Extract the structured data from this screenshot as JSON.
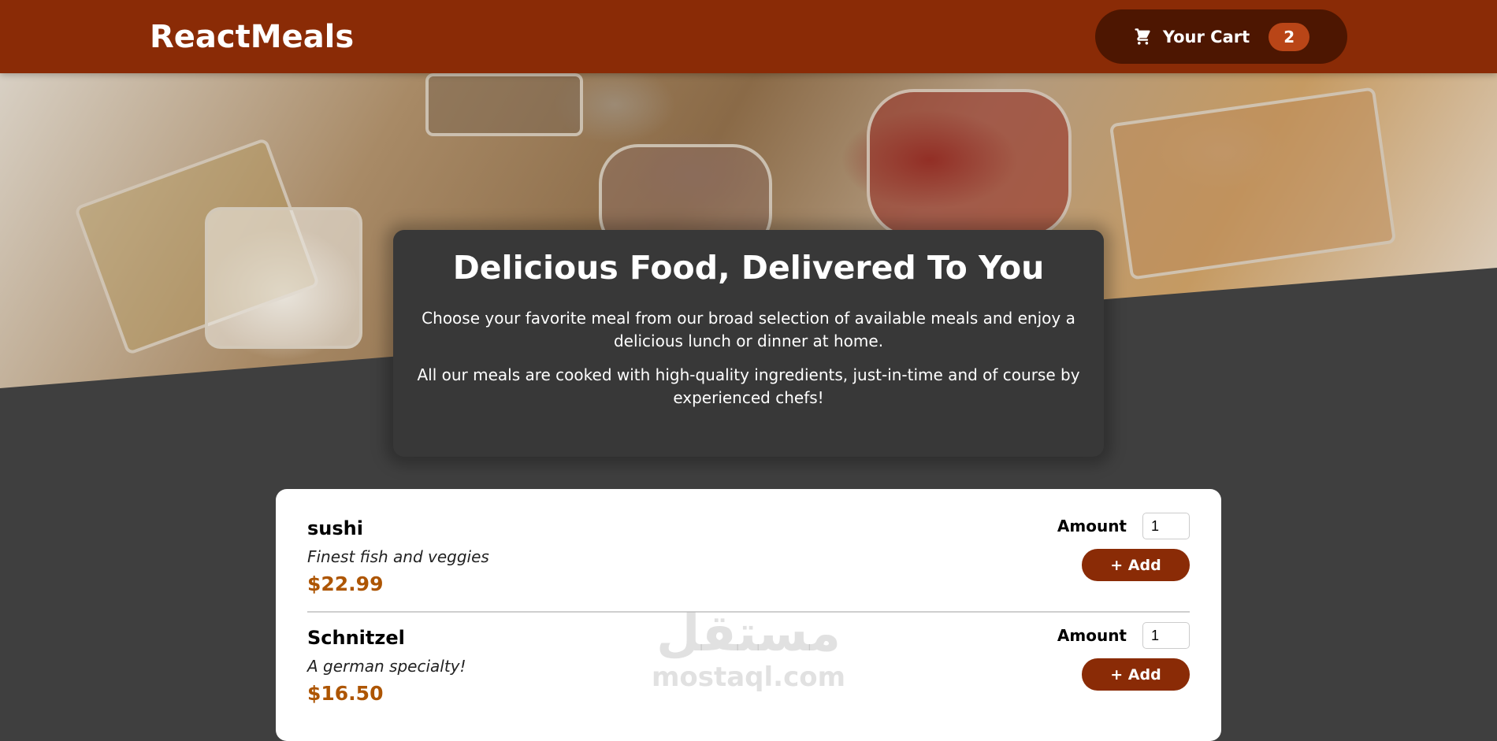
{
  "header": {
    "brand": "ReactMeals",
    "cart": {
      "icon": "cart-icon",
      "label": "Your Cart",
      "count": "2"
    }
  },
  "hero": {
    "image": "buffet-table-image"
  },
  "summary": {
    "title": "Delicious Food, Delivered To You",
    "paragraph1": "Choose your favorite meal from our broad selection of available meals and enjoy a delicious lunch or dinner at home.",
    "paragraph2": "All our meals are cooked with high-quality ingredients, just-in-time and of course by experienced chefs!"
  },
  "meals": [
    {
      "name": "sushi",
      "description": "Finest fish and veggies",
      "price": "$22.99",
      "amount_label": "Amount",
      "amount_value": "1",
      "add_label": "+ Add"
    },
    {
      "name": "Schnitzel",
      "description": "A german specialty!",
      "price": "$16.50",
      "amount_label": "Amount",
      "amount_value": "1",
      "add_label": "+ Add"
    }
  ],
  "watermark": {
    "arabic": "مستقل",
    "latin": "mostaql.com"
  },
  "colors": {
    "header_bg": "#8a2b06",
    "cart_bg": "#4d1601",
    "badge_bg": "#b94517",
    "page_bg": "#3f3f3f",
    "summary_bg": "#383838",
    "price": "#ad5502"
  }
}
